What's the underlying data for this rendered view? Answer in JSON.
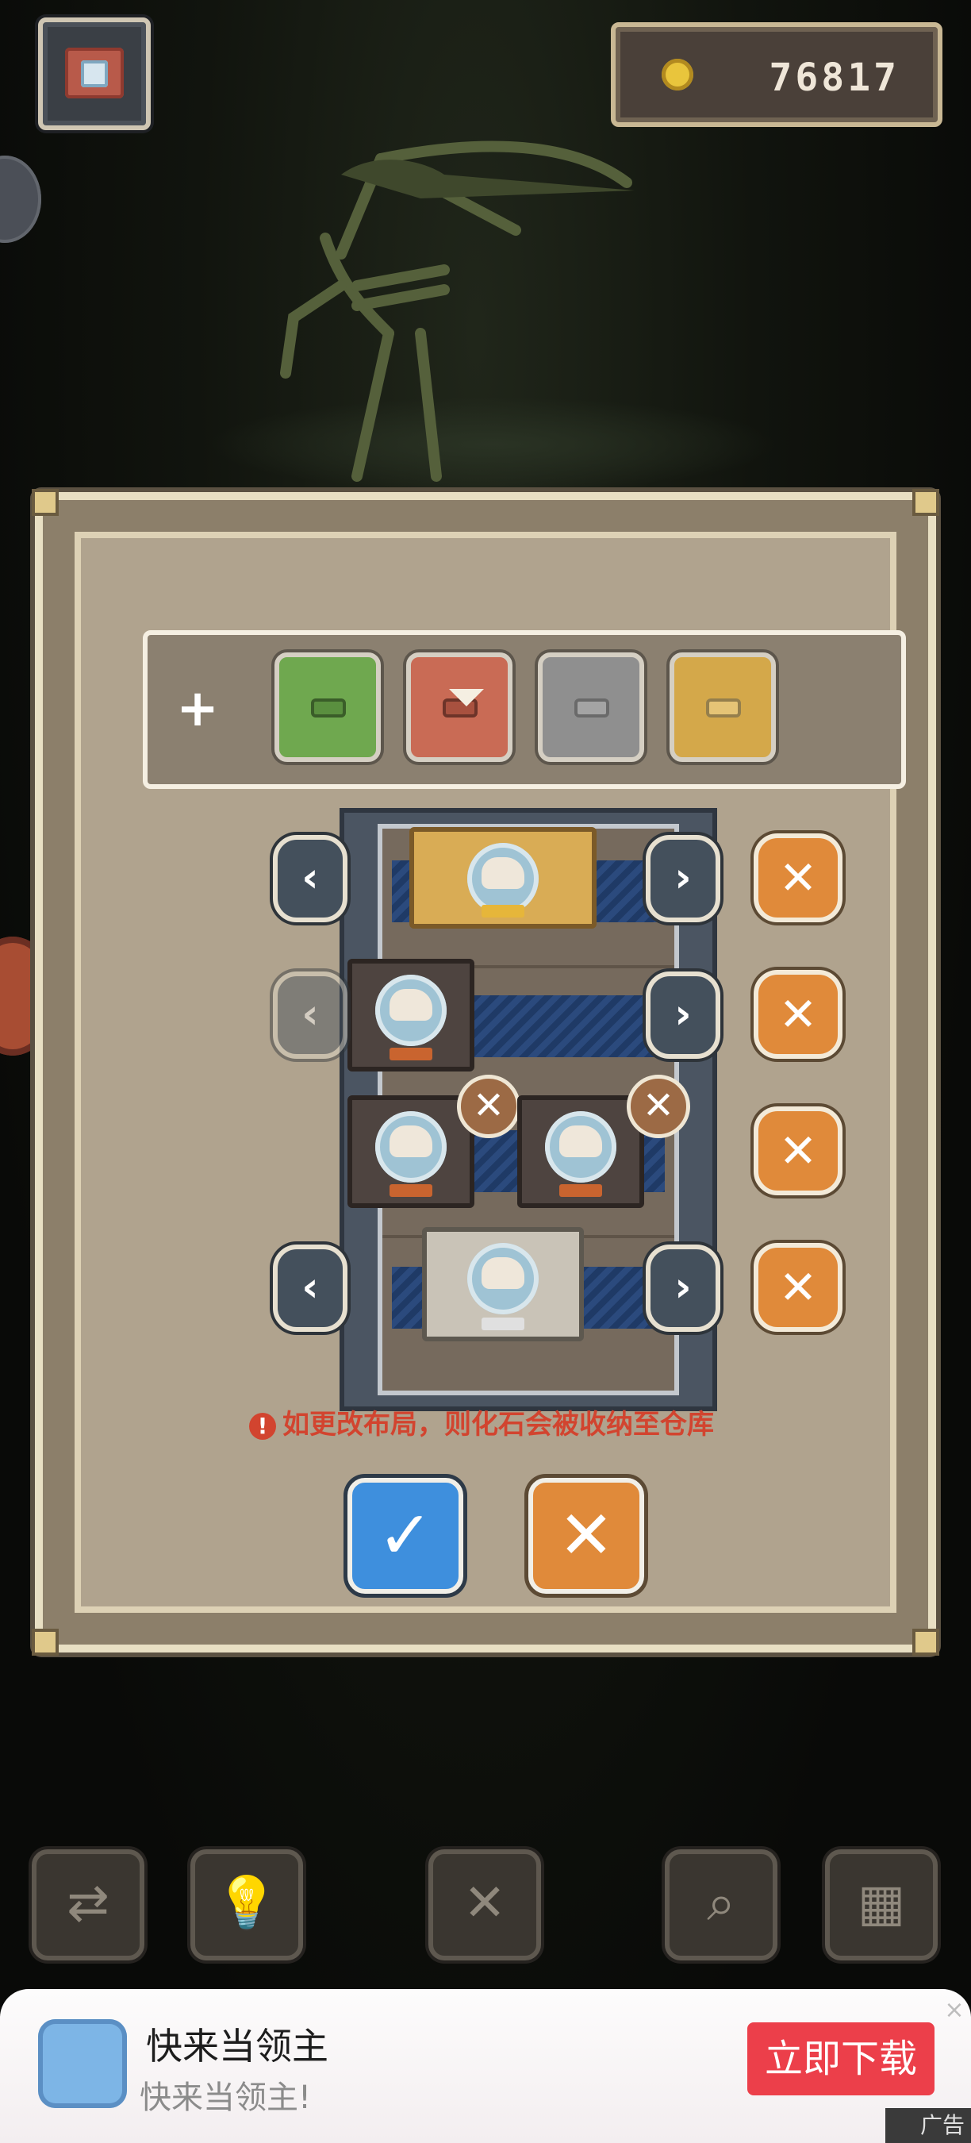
{
  "header": {
    "camera_icon": "camera-icon",
    "coin_icon": "coin-icon",
    "coins": "76817"
  },
  "panel": {
    "add_label": "+",
    "swatches": [
      {
        "name": "green",
        "color": "#6fa84f"
      },
      {
        "name": "red",
        "color": "#c96b55"
      },
      {
        "name": "gray",
        "color": "#8f8f8f"
      },
      {
        "name": "gold",
        "color": "#d4a84a"
      }
    ],
    "arrow_left": "‹",
    "arrow_right": "›",
    "remove_label": "✕",
    "warning_icon": "!",
    "warning_text": "如更改布局，则化石会被收纳至仓库",
    "confirm_label": "✓",
    "cancel_label": "✕"
  },
  "toolbar": {
    "icons": [
      "swap-icon",
      "lightbulb-icon",
      "close-icon",
      "magnifier-icon",
      "map-icon"
    ],
    "close_label": "✕"
  },
  "ad": {
    "title": "快来当领主",
    "subtitle": "快来当领主!",
    "button": "立即下载",
    "close": "×",
    "tag": "广告"
  },
  "colors": {
    "accent_orange": "#e08a3a",
    "confirm_blue": "#3e8fdd",
    "warning_red": "#d2442f",
    "ad_red": "#ec3f4a"
  }
}
